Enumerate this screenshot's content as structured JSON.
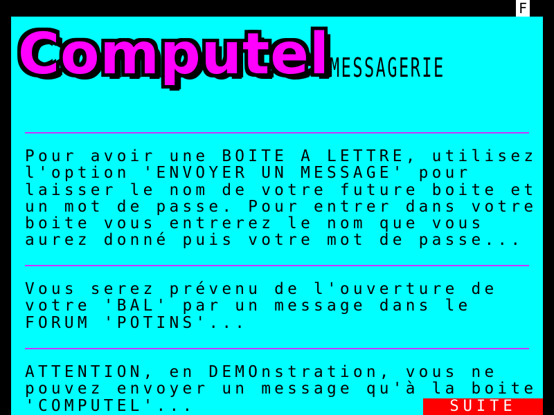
{
  "status": {
    "indicator": "F"
  },
  "header": {
    "logo_text": "Computel",
    "subtitle": "MESSAGERIE"
  },
  "content": {
    "paragraph1": [
      "Pour avoir une BOITE A LETTRE, utilisez",
      "l'option 'ENVOYER UN MESSAGE' pour",
      "laisser le nom de votre future boite et",
      "un mot de passe. Pour entrer dans votre",
      "boite vous entrerez le nom que vous",
      "aurez donné puis votre mot de passe..."
    ],
    "paragraph2": [
      "Vous serez prévenu de l'ouverture de",
      "votre 'BAL' par un message dans le",
      "FORUM 'POTINS'..."
    ],
    "paragraph3": [
      "ATTENTION, en DEMOnstration, vous ne",
      "pouvez envoyer un message qu'à la boite",
      "'COMPUTEL'..."
    ]
  },
  "footer": {
    "next_label": "SUITE"
  },
  "colors": {
    "background": "#00ffff",
    "logo": "#ff00ff",
    "divider": "#cc33ff",
    "next_button": "#ff0000"
  }
}
